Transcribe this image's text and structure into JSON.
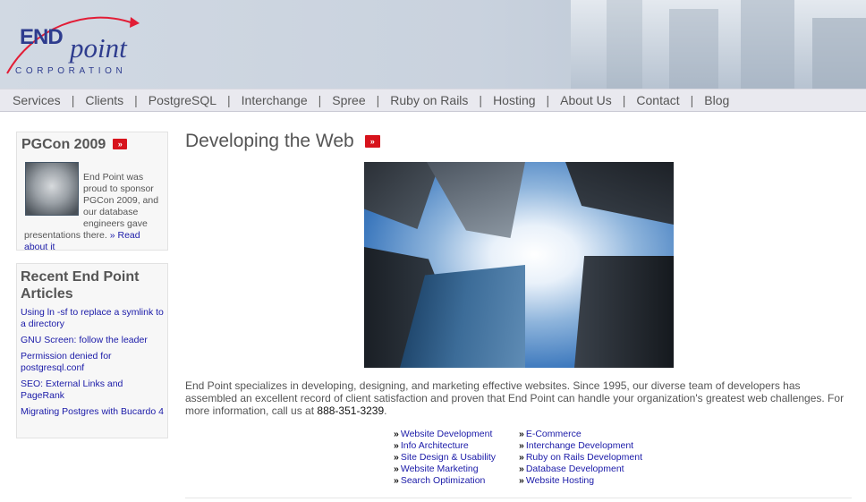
{
  "header": {
    "logo_end": "END",
    "logo_point": "point",
    "logo_corp": "CORPORATION"
  },
  "nav": {
    "items": [
      "Services",
      "Clients",
      "PostgreSQL",
      "Interchange",
      "Spree",
      "Ruby on Rails",
      "Hosting",
      "About Us",
      "Contact",
      "Blog"
    ],
    "separator": "|"
  },
  "pgcon": {
    "title": "PGCon 2009",
    "badge": "»",
    "text": "End Point was proud to sponsor PGCon 2009, and our database engineers gave presentations there.",
    "link": "» Read about it"
  },
  "recent": {
    "title": "Recent End Point Articles",
    "items": [
      "Using ln -sf to replace a symlink to a directory",
      "GNU Screen: follow the leader",
      "Permission denied for postgresql.conf",
      "SEO: External Links and PageRank",
      "Migrating Postgres with Bucardo 4"
    ]
  },
  "main": {
    "title": "Developing the Web",
    "badge": "»",
    "intro": "End Point specializes in developing, designing, and marketing effective websites. Since 1995, our diverse team of developers has assembled an excellent record of client satisfaction and proven that End Point can handle your organization's greatest web challenges. For more information, call us at",
    "phone": "888-351-3239",
    "phone_suffix": ".",
    "bullet": "»",
    "services_col1": [
      "Website Development",
      "Info Architecture",
      "Site Design & Usability",
      "Website Marketing",
      "Search Optimization"
    ],
    "services_col2": [
      "E-Commerce",
      "Interchange Development",
      "Ruby on Rails Development",
      "Database Development",
      "Website Hosting"
    ]
  },
  "colors": {
    "brand_blue": "#2e3c8e",
    "link_blue": "#1a1aa8",
    "badge_red": "#d7131c",
    "logo_swoosh": "#e21d36"
  }
}
